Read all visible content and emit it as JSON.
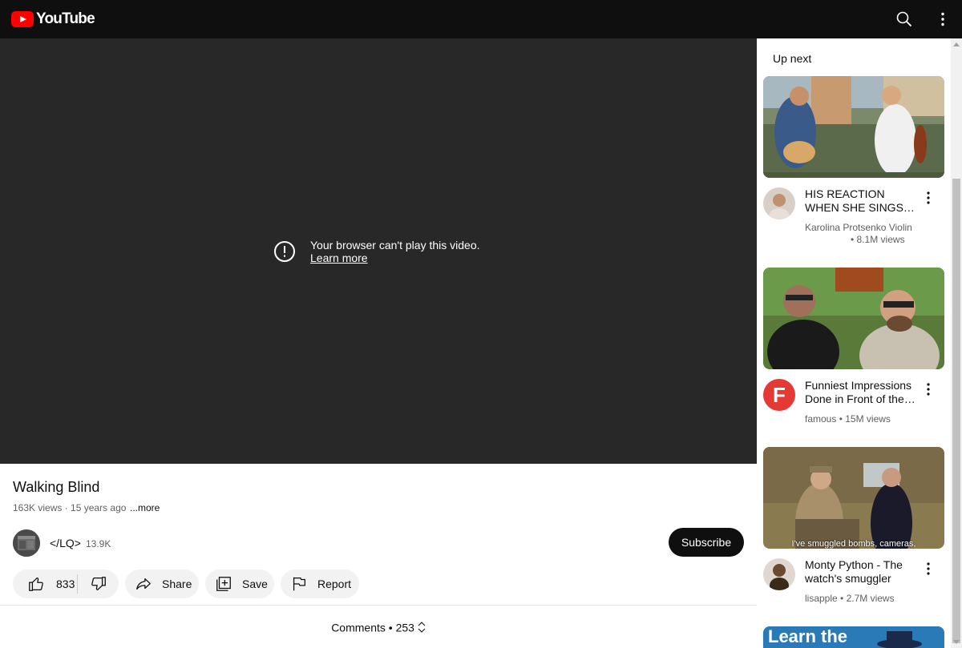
{
  "app": {
    "logo_text": "YouTube"
  },
  "player": {
    "error_message": "Your browser can't play this video.",
    "error_link": "Learn more"
  },
  "video": {
    "title": "Walking Blind",
    "meta": "163K views · 15 years ago",
    "more": "...more",
    "channel_name": "</LQ>",
    "subscribers": "13.9K",
    "subscribe_label": "Subscribe",
    "likes": "833",
    "share_label": "Share",
    "save_label": "Save",
    "report_label": "Report",
    "comments_label": "Comments",
    "comments_count": "253"
  },
  "sidebar": {
    "heading": "Up next",
    "items": [
      {
        "title": "HIS REACTION WHEN SHE SINGS | Ellie Goulding",
        "channel": "Karolina Protsenko Violin",
        "views": "8.1M views"
      },
      {
        "title": "Funniest Impressions Done in Front of the Celebrities",
        "channel": "famous",
        "views": "15M views"
      },
      {
        "title": "Monty Python - The watch's smuggler",
        "channel": "lisapple",
        "views": "2.7M views"
      }
    ],
    "partial_thumb_text": "Learn the",
    "subtitle_text": "I've smuggled bombs, cameras,",
    "channel_letter": "F"
  },
  "colors": {
    "brand": "#ff0000",
    "topbar": "#0f0f0f",
    "player_bg": "#282828"
  },
  "icons": [
    "search-icon",
    "more-vert-icon",
    "alert-icon",
    "thumb-up-icon",
    "thumb-down-icon",
    "share-icon",
    "save-icon",
    "flag-icon",
    "sort-icon"
  ]
}
